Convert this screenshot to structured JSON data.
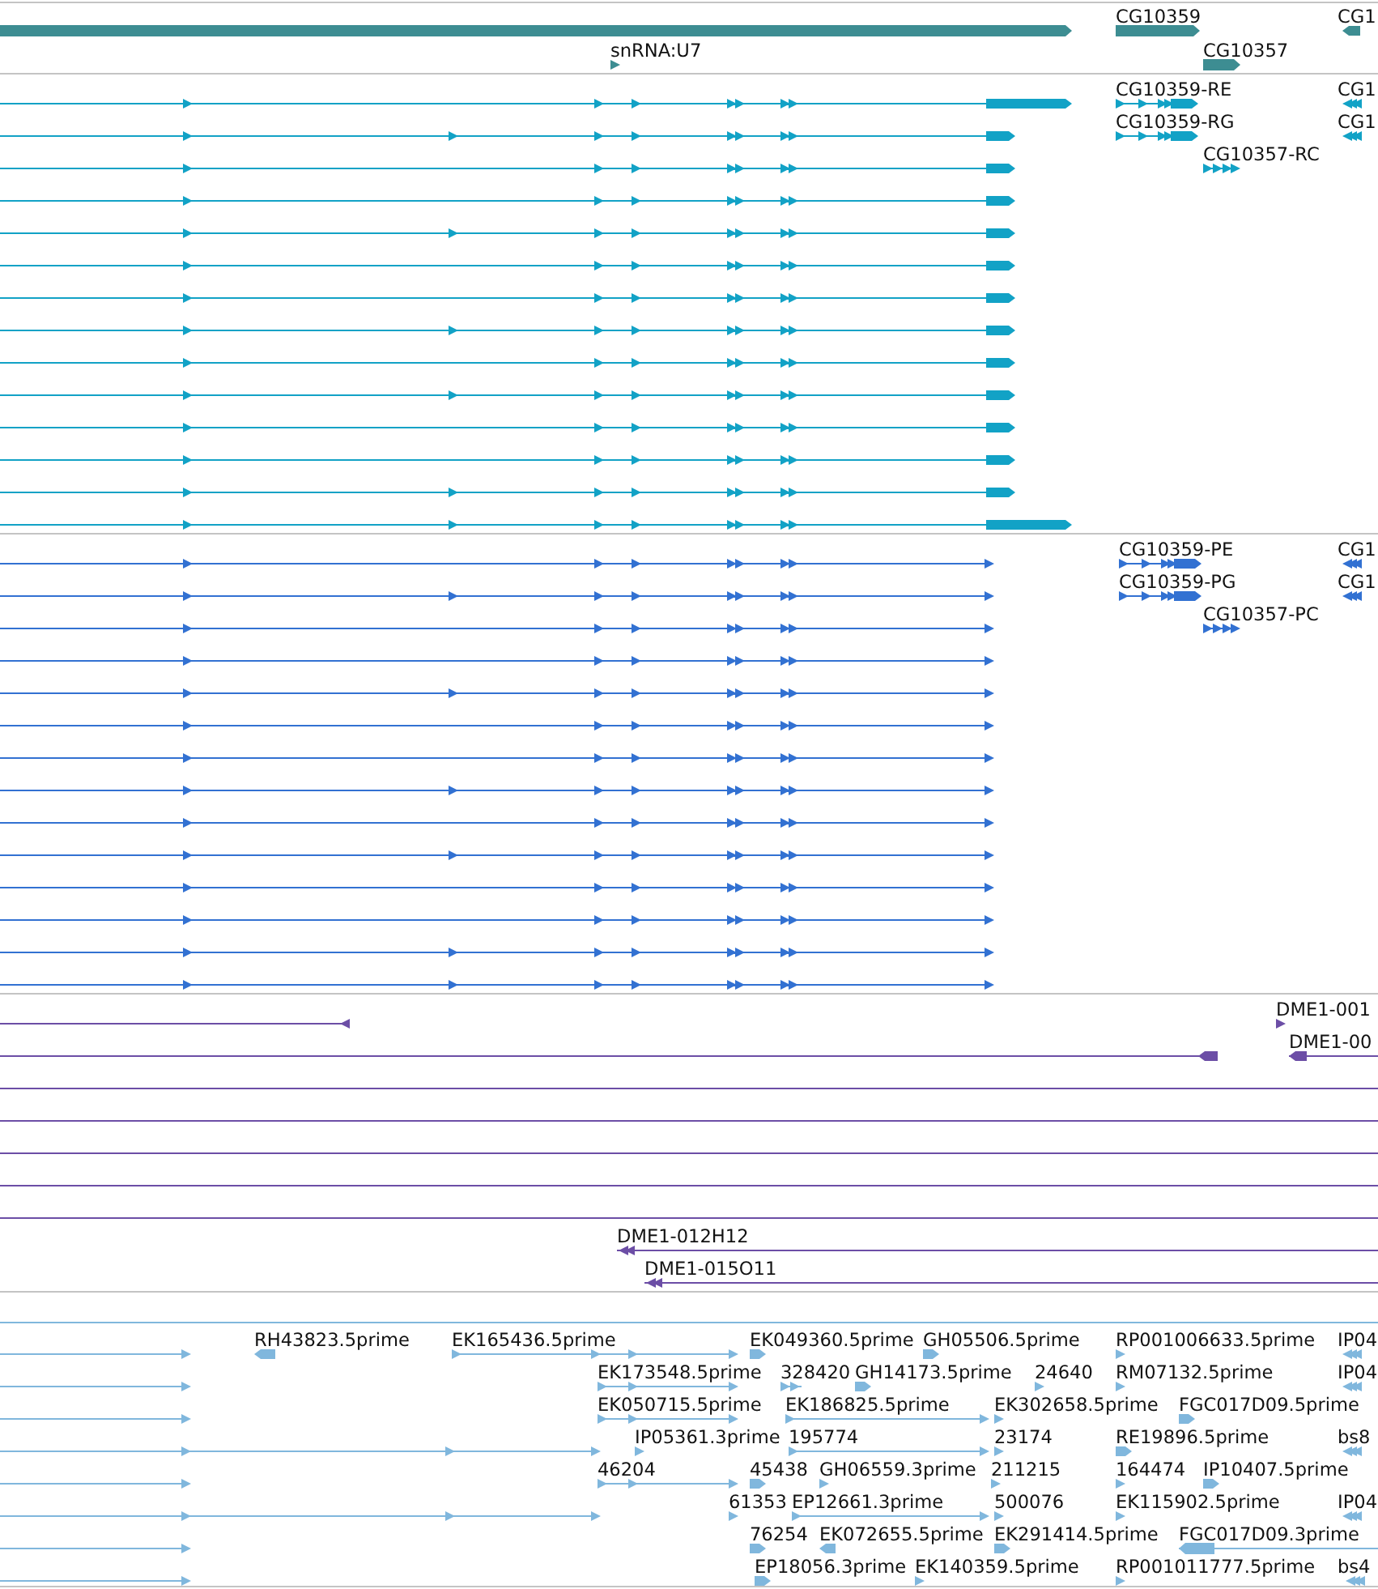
{
  "tracks": [
    {
      "kind": "genes",
      "color": "#3d8d92",
      "features": [
        {
          "label": "CG10359"
        },
        {
          "label": "CG1"
        },
        {
          "label": "snRNA:U7"
        },
        {
          "label": "CG10357"
        }
      ]
    },
    {
      "kind": "transcripts",
      "color": "#12a2c6",
      "features": [
        {
          "label": "CG10359-RE"
        },
        {
          "label": "CG1"
        },
        {
          "label": "CG10359-RG"
        },
        {
          "label": "CG1"
        },
        {
          "label": "CG10357-RC"
        }
      ]
    },
    {
      "kind": "proteins",
      "color": "#3271d2",
      "features": [
        {
          "label": "CG10359-PE"
        },
        {
          "label": "CG1"
        },
        {
          "label": "CG10359-PG"
        },
        {
          "label": "CG1"
        },
        {
          "label": "CG10357-PC"
        }
      ]
    },
    {
      "kind": "clones",
      "color": "#6c4ea6",
      "features": [
        {
          "label": "DME1-001"
        },
        {
          "label": "DME1-00"
        },
        {
          "label": "DME1-012H12"
        },
        {
          "label": "DME1-015O11"
        }
      ]
    },
    {
      "kind": "ests",
      "color": "#80b7dd",
      "features": [
        {
          "label": "RH43823.5prime"
        },
        {
          "label": "EK165436.5prime"
        },
        {
          "label": "EK049360.5prime"
        },
        {
          "label": "GH05506.5prime"
        },
        {
          "label": "RP001006633.5prime"
        },
        {
          "label": "IP04"
        },
        {
          "label": "EK173548.5prime"
        },
        {
          "label": "328420"
        },
        {
          "label": "GH14173.5prime"
        },
        {
          "label": "24640"
        },
        {
          "label": "RM07132.5prime"
        },
        {
          "label": "IP04"
        },
        {
          "label": "EK050715.5prime"
        },
        {
          "label": "EK186825.5prime"
        },
        {
          "label": "EK302658.5prime"
        },
        {
          "label": "FGC017D09.5prime"
        },
        {
          "label": "IP05361.3prime"
        },
        {
          "label": "195774"
        },
        {
          "label": "23174"
        },
        {
          "label": "RE19896.5prime"
        },
        {
          "label": "bs8"
        },
        {
          "label": "46204"
        },
        {
          "label": "45438"
        },
        {
          "label": "GH06559.3prime"
        },
        {
          "label": "211215"
        },
        {
          "label": "164474"
        },
        {
          "label": "IP10407.5prime"
        },
        {
          "label": "61353"
        },
        {
          "label": "EP12661.3prime"
        },
        {
          "label": "500076"
        },
        {
          "label": "EK115902.5prime"
        },
        {
          "label": "IP04"
        },
        {
          "label": "76254"
        },
        {
          "label": "EK072655.5prime"
        },
        {
          "label": "EK291414.5prime"
        },
        {
          "label": "FGC017D09.3prime"
        },
        {
          "label": "EP18056.3prime"
        },
        {
          "label": "EK140359.5prime"
        },
        {
          "label": "RP001011777.5prime"
        },
        {
          "label": "bs4"
        }
      ]
    }
  ]
}
